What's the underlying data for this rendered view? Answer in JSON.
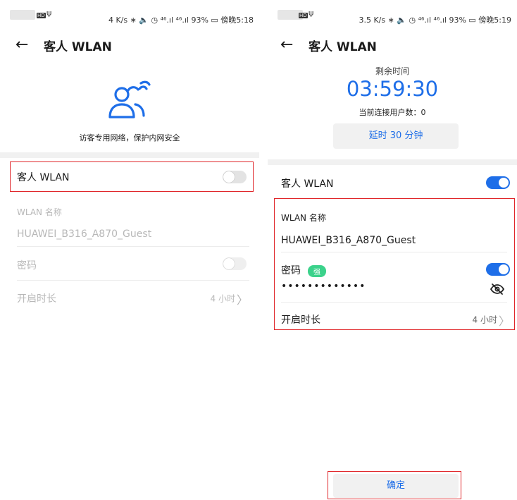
{
  "left": {
    "status": {
      "text": "4 K/s ∗ 🔈 ◷ ⁴⁶.ıl ⁴⁶.ıl 93% ▭ 傍晚5:18",
      "hd": "HD",
      "usb": "ψ"
    },
    "title": "客人 WLAN",
    "hero_text": "访客专用网络，保护内网安全",
    "guest_wlan_label": "客人 WLAN",
    "guest_wlan_enabled": false,
    "wlan_name_label": "WLAN 名称",
    "wlan_name_value": "HUAWEI_B316_A870_Guest",
    "password_label": "密码",
    "duration_label": "开启时长",
    "duration_value": "4 小时"
  },
  "right": {
    "status": {
      "text": "3.5 K/s ∗ 🔈 ◷ ⁴⁶.ıl ⁴⁶.ıl 93% ▭ 傍晚5:19",
      "hd": "HD",
      "usb": "ψ"
    },
    "title": "客人 WLAN",
    "remaining_label": "剩余时间",
    "remaining_time": "03:59:30",
    "users_text": "当前连接用户数：0",
    "extend_button": "延时 30 分钟",
    "guest_wlan_label": "客人 WLAN",
    "guest_wlan_enabled": true,
    "wlan_name_label": "WLAN 名称",
    "wlan_name_value": "HUAWEI_B316_A870_Guest",
    "password_label": "密码",
    "password_strength": "强",
    "password_dots": "•••••••••••••",
    "duration_label": "开启时长",
    "duration_value": "4 小时",
    "confirm_button": "确定"
  },
  "colors": {
    "accent": "#1e6ee8",
    "highlight": "#e0262a",
    "strength": "#3bd28b"
  },
  "icons": [
    "back-arrow-icon",
    "guest-users-wifi-icon",
    "chevron-right-icon",
    "eye-off-icon"
  ]
}
